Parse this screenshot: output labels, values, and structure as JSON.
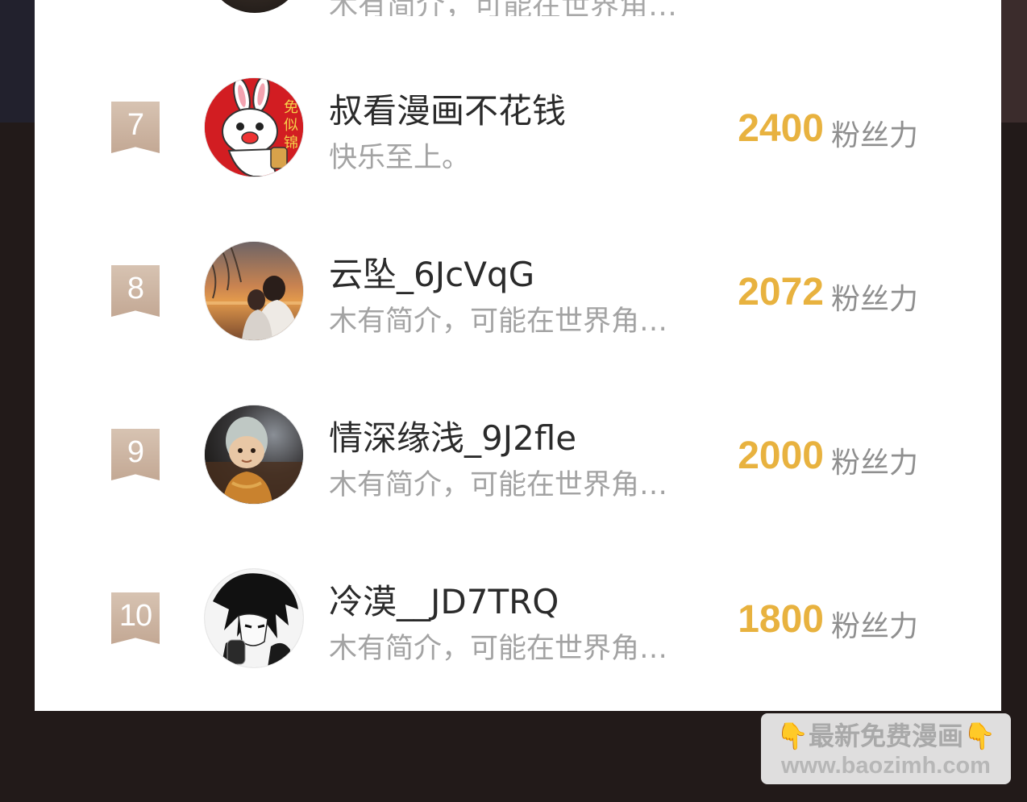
{
  "previous_row_intro": "木有简介，可能在世界角…",
  "fan_rows": [
    {
      "rank": "7",
      "username": "叔看漫画不花钱",
      "intro": "快乐至上。",
      "score": "2400",
      "unit": "粉丝力",
      "avatar": "rabbit-avatar"
    },
    {
      "rank": "8",
      "username": "云坠_6JcVqG",
      "intro": "木有简介，可能在世界角…",
      "score": "2072",
      "unit": "粉丝力",
      "avatar": "sunset-couple-avatar"
    },
    {
      "rank": "9",
      "username": "情深缘浅_9J2fle",
      "intro": "木有简介，可能在世界角…",
      "score": "2000",
      "unit": "粉丝力",
      "avatar": "cartoon-monk-avatar"
    },
    {
      "rank": "10",
      "username": "冷漠__JD7TRQ",
      "intro": "木有简介，可能在世界角…",
      "score": "1800",
      "unit": "粉丝力",
      "avatar": "manga-character-avatar"
    }
  ],
  "watermark": {
    "line1": "最新免费漫画",
    "line2": "www.baozimh.com",
    "hand_icon": "pointing-down-hand"
  },
  "colors": {
    "score": "#e8b23f",
    "rank_badge": "#c9ae99",
    "backdrop": "#221a19"
  }
}
